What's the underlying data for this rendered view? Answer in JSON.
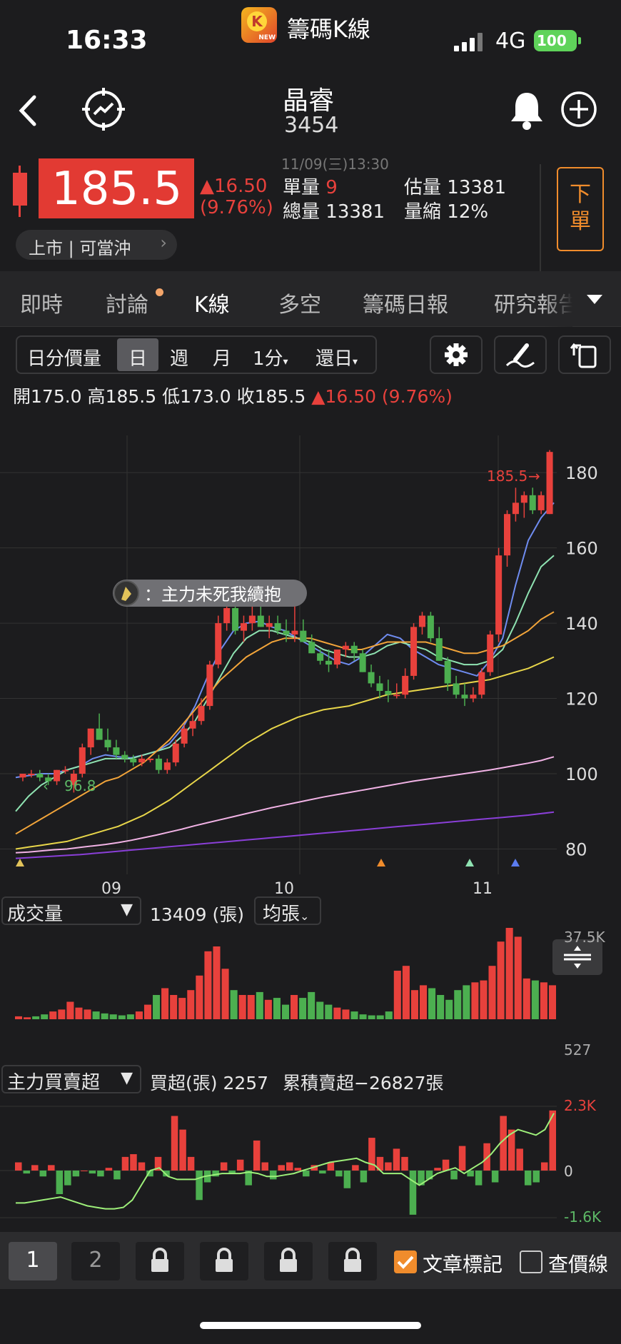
{
  "status": {
    "time": "16:33",
    "app_name": "籌碼K線",
    "network": "4G",
    "battery": "100"
  },
  "header": {
    "stock_name": "晶睿",
    "stock_code": "3454"
  },
  "quote": {
    "price": "185.5",
    "change": "▲16.50",
    "change_pct": "(9.76%)",
    "datetime": "11/09(三)13:30",
    "single_vol_label": "單量",
    "single_vol": "9",
    "total_vol_label": "總量",
    "total_vol": "13381",
    "est_vol_label": "估量",
    "est_vol": "13381",
    "vol_shrink_label": "量縮",
    "vol_shrink": "12%",
    "market_tag": "上市 | 可當沖",
    "order_button": "下單"
  },
  "tabs": [
    "即時",
    "討論",
    "K線",
    "多空",
    "籌碼日報",
    "研究報告"
  ],
  "active_tab": "K線",
  "period": {
    "items": [
      "日分價量",
      "日",
      "週",
      "月",
      "1分",
      "還日"
    ],
    "active": "日"
  },
  "ohlc": {
    "open_label": "開",
    "open": "175.0",
    "high_label": "高",
    "high": "185.5",
    "low_label": "低",
    "low": "173.0",
    "close_label": "收",
    "close": "185.5",
    "change": "▲16.50 (9.76%)"
  },
  "annotations": {
    "last_price": "185.5",
    "low_marker": "96.8",
    "bubble": "：主力未死我續抱"
  },
  "volume_panel": {
    "selector": "成交量",
    "value": "13409 (張)",
    "mode": "均張",
    "max_label": "37.5K",
    "min_label": "527"
  },
  "main_force_panel": {
    "selector": "主力買賣超",
    "buy_over": "買超(張) 2257",
    "cumulative": "累積賣超−26827張",
    "max_label": "2.3K",
    "zero_label": "0",
    "min_label": "-1.6K"
  },
  "bottom": {
    "pages": [
      "1",
      "2"
    ],
    "article_mark": "文章標記",
    "price_line": "查價線"
  },
  "colors": {
    "up": "#e8413c",
    "down": "#4caf50",
    "accent": "#f08c2c",
    "bg": "#1c1c1e"
  },
  "chart_data": {
    "type": "candlestick",
    "x_tick_labels": [
      "09",
      "10",
      "11"
    ],
    "y_ticks": [
      80,
      100,
      120,
      140,
      160,
      180
    ],
    "ylim": [
      78,
      188
    ],
    "candles": [
      [
        99,
        100,
        98,
        100
      ],
      [
        100,
        101,
        99,
        100
      ],
      [
        100,
        101,
        98,
        99
      ],
      [
        99,
        100,
        97,
        98
      ],
      [
        98,
        101,
        97,
        101
      ],
      [
        101,
        102,
        100,
        101
      ],
      [
        97,
        101,
        95,
        100
      ],
      [
        100,
        108,
        99,
        107
      ],
      [
        107,
        112,
        105,
        112
      ],
      [
        112,
        116,
        110,
        109
      ],
      [
        109,
        112,
        106,
        107
      ],
      [
        107,
        109,
        104,
        105
      ],
      [
        105,
        106,
        103,
        104
      ],
      [
        104,
        105,
        102,
        103
      ],
      [
        103,
        105,
        102,
        104
      ],
      [
        104,
        104,
        103,
        104
      ],
      [
        104,
        105,
        100,
        101
      ],
      [
        101,
        104,
        100,
        103
      ],
      [
        103,
        109,
        102,
        108
      ],
      [
        108,
        113,
        107,
        112
      ],
      [
        112,
        116,
        110,
        114
      ],
      [
        114,
        120,
        113,
        118
      ],
      [
        118,
        130,
        117,
        129
      ],
      [
        129,
        142,
        128,
        140
      ],
      [
        140,
        146,
        138,
        144
      ],
      [
        144,
        146,
        137,
        138
      ],
      [
        138,
        142,
        135,
        140
      ],
      [
        140,
        145,
        138,
        142
      ],
      [
        142,
        147,
        139,
        139
      ],
      [
        139,
        142,
        136,
        140
      ],
      [
        140,
        142,
        137,
        138
      ],
      [
        138,
        141,
        135,
        137
      ],
      [
        137,
        146,
        135,
        138
      ],
      [
        138,
        141,
        135,
        135
      ],
      [
        135,
        137,
        132,
        132
      ],
      [
        132,
        133,
        129,
        130
      ],
      [
        130,
        133,
        127,
        129
      ],
      [
        129,
        133,
        128,
        133
      ],
      [
        133,
        135,
        131,
        134
      ],
      [
        134,
        135,
        130,
        132
      ],
      [
        132,
        133,
        127,
        127
      ],
      [
        127,
        129,
        123,
        124
      ],
      [
        124,
        126,
        120,
        122
      ],
      [
        122,
        125,
        119,
        121
      ],
      [
        121,
        124,
        120,
        121
      ],
      [
        121,
        128,
        120,
        126
      ],
      [
        126,
        140,
        125,
        139
      ],
      [
        139,
        143,
        137,
        142
      ],
      [
        142,
        143,
        135,
        136
      ],
      [
        136,
        139,
        130,
        130
      ],
      [
        130,
        131,
        122,
        124
      ],
      [
        124,
        126,
        120,
        121
      ],
      [
        121,
        124,
        118,
        120
      ],
      [
        120,
        123,
        119,
        121
      ],
      [
        121,
        128,
        120,
        127
      ],
      [
        127,
        138,
        126,
        137
      ],
      [
        137,
        160,
        135,
        158
      ],
      [
        158,
        170,
        155,
        169
      ],
      [
        169,
        176,
        167,
        172
      ],
      [
        172,
        175,
        168,
        174
      ],
      [
        174,
        176,
        169,
        170
      ],
      [
        170,
        175,
        169,
        174
      ],
      [
        169,
        186,
        169,
        185.5
      ]
    ],
    "ma_series": [
      {
        "color": "#6f8cf0",
        "values": [
          99,
          99.5,
          100,
          100,
          101,
          102,
          104,
          105,
          104.5,
          104.2,
          105,
          106,
          108,
          112,
          118,
          126,
          133,
          138,
          140,
          140.5,
          139,
          138,
          136,
          134,
          132,
          130,
          129,
          131,
          134,
          137,
          136,
          133,
          131,
          129,
          128,
          127,
          126,
          130,
          136,
          150,
          162,
          168,
          172
        ]
      },
      {
        "color": "#8fe3b2",
        "values": [
          90,
          94,
          97,
          99,
          101,
          102,
          103,
          104,
          104,
          104,
          105,
          106,
          107,
          110,
          114,
          120,
          126,
          132,
          136,
          138,
          138,
          137,
          136,
          135,
          133,
          132,
          131,
          131,
          132,
          134,
          135,
          134,
          133,
          131,
          130,
          129,
          129,
          130,
          133,
          140,
          148,
          155,
          158
        ]
      },
      {
        "color": "#f3a53a",
        "values": [
          84,
          86,
          88,
          90,
          92,
          94,
          96,
          98,
          99,
          101,
          103,
          106,
          109,
          113,
          117,
          121,
          125,
          128,
          131,
          133,
          135,
          136,
          136,
          136,
          135,
          134,
          133,
          133,
          134,
          135,
          135,
          135,
          135,
          134,
          133,
          132,
          132,
          133,
          134,
          136,
          138,
          141,
          143
        ]
      },
      {
        "color": "#e8d64a",
        "values": [
          80,
          80.5,
          81,
          81.5,
          82,
          83,
          84,
          85,
          86,
          87.5,
          89,
          91,
          93,
          95.5,
          98,
          100.5,
          103,
          105.5,
          108,
          110,
          112,
          113.5,
          115,
          116,
          117,
          117.5,
          118,
          119,
          120,
          121,
          121.5,
          122,
          122.5,
          123,
          123.5,
          124,
          124.5,
          125,
          126,
          127,
          128,
          129.5,
          131
        ]
      },
      {
        "color": "#f2b3e6",
        "values": [
          79,
          79.2,
          79.5,
          79.8,
          80,
          80.4,
          80.8,
          81.2,
          81.7,
          82.3,
          83,
          83.7,
          84.5,
          85.3,
          86.2,
          87,
          87.8,
          88.6,
          89.4,
          90.2,
          91,
          91.7,
          92.4,
          93.1,
          93.8,
          94.4,
          95,
          95.6,
          96.2,
          96.8,
          97.4,
          98,
          98.5,
          99,
          99.5,
          100,
          100.5,
          101,
          101.6,
          102.2,
          102.8,
          103.5,
          104.5
        ]
      },
      {
        "color": "#8a3fd8",
        "values": [
          77.5,
          77.7,
          77.9,
          78.1,
          78.3,
          78.5,
          78.8,
          79.1,
          79.4,
          79.7,
          80,
          80.3,
          80.6,
          80.9,
          81.2,
          81.5,
          81.8,
          82.1,
          82.4,
          82.7,
          83,
          83.3,
          83.6,
          83.9,
          84.2,
          84.5,
          84.8,
          85.1,
          85.4,
          85.7,
          86,
          86.3,
          86.6,
          86.9,
          87.2,
          87.5,
          87.8,
          88.1,
          88.4,
          88.7,
          89,
          89.4,
          89.8
        ]
      }
    ],
    "volume": [
      0.3,
      0.2,
      0.3,
      0.5,
      0.8,
      1.0,
      1.8,
      1.2,
      1.0,
      0.8,
      0.6,
      0.5,
      0.4,
      0.5,
      0.8,
      1.5,
      2.5,
      3.2,
      2.5,
      2.2,
      3.0,
      4.5,
      7.0,
      7.5,
      5.2,
      3.0,
      2.5,
      2.5,
      2.8,
      2.0,
      2.2,
      1.5,
      2.5,
      2.2,
      2.8,
      1.8,
      1.5,
      1.2,
      1.0,
      0.8,
      0.5,
      0.4,
      0.4,
      0.8,
      5.0,
      5.5,
      3.0,
      3.5,
      3.2,
      2.5,
      2.0,
      3.0,
      3.5,
      3.8,
      4.0,
      5.5,
      8.0,
      10.0,
      8.5,
      4.2,
      4.0,
      3.8,
      3.5
    ],
    "main_force": [
      0.3,
      -0.1,
      0.2,
      -0.2,
      0.2,
      -0.8,
      -0.5,
      -0.2,
      0,
      -0.1,
      -0.2,
      0.1,
      -0.3,
      0.5,
      0.6,
      0.3,
      -0.2,
      0.5,
      -0.2,
      2.0,
      1.5,
      0.5,
      -1.0,
      -0.4,
      -0.2,
      0.3,
      -0.1,
      0.4,
      -0.5,
      1.1,
      0.3,
      -0.3,
      0.2,
      0.3,
      0.1,
      -0.2,
      0.2,
      -0.1,
      0.3,
      -0.2,
      -0.6,
      0.2,
      -0.4,
      1.2,
      0.5,
      0.3,
      0.8,
      0.5,
      -1.5,
      -0.5,
      -0.3,
      0.1,
      0.4,
      -0.3,
      0.9,
      -0.2,
      -0.5,
      1.0,
      -0.4,
      2.0,
      1.5,
      0.8,
      -0.5,
      -0.4,
      0.3,
      2.2
    ],
    "cumulative_curve": [
      -1.1,
      -1.1,
      -1.05,
      -1.0,
      -0.95,
      -0.9,
      -1.0,
      -1.1,
      -1.2,
      -1.25,
      -1.3,
      -1.3,
      -1.25,
      -1.0,
      -0.5,
      0,
      0.1,
      -0.2,
      -0.3,
      -0.3,
      -0.3,
      -0.2,
      -0.15,
      -0.1,
      -0.1,
      -0.1,
      -0.05,
      -0.1,
      -0.2,
      -0.2,
      -0.15,
      -0.1,
      0,
      0.1,
      0.2,
      0.3,
      0.35,
      0.4,
      0.45,
      0.3,
      0.2,
      -0.1,
      -0.1,
      -0.1,
      -0.3,
      -0.5,
      -0.3,
      -0.1,
      0,
      0.1,
      -0.1,
      0.1,
      0.3,
      0.6,
      1.0,
      1.3,
      1.5,
      1.4,
      1.3,
      1.5,
      2.1
    ]
  }
}
